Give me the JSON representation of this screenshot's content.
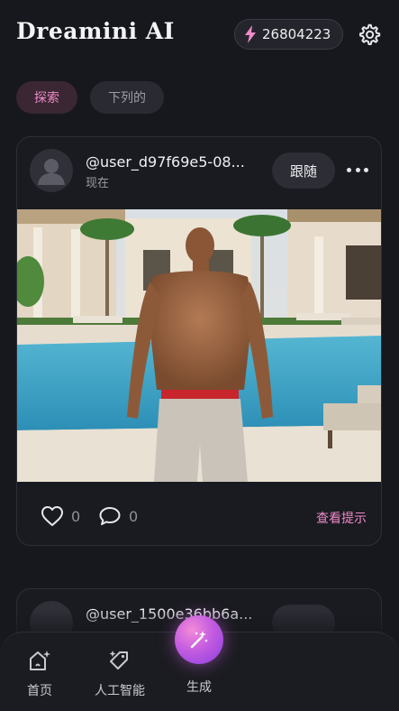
{
  "header": {
    "title": "Dreamini AI",
    "credits": "26804223",
    "credits_icon": "lightning-icon",
    "settings_icon": "gear-icon"
  },
  "tabs": [
    {
      "label": "探索",
      "active": true
    },
    {
      "label": "下列的",
      "active": false
    }
  ],
  "post": {
    "username": "@user_d97f69e5-08...",
    "timestamp": "现在",
    "follow_label": "跟随",
    "likes": "0",
    "comments": "0",
    "view_prompt_label": "查看提示"
  },
  "next_post": {
    "username": "@user_1500e36bb6a..."
  },
  "bottom_nav": {
    "items": [
      {
        "label": "首页",
        "icon": "home-sparkle-icon"
      },
      {
        "label": "人工智能",
        "icon": "ai-tag-icon"
      },
      {
        "label": "生成",
        "icon": "magic-wand-icon"
      }
    ]
  },
  "colors": {
    "background": "#17181d",
    "accent_pink": "#f08ac8",
    "card_border": "#2e2f37"
  }
}
